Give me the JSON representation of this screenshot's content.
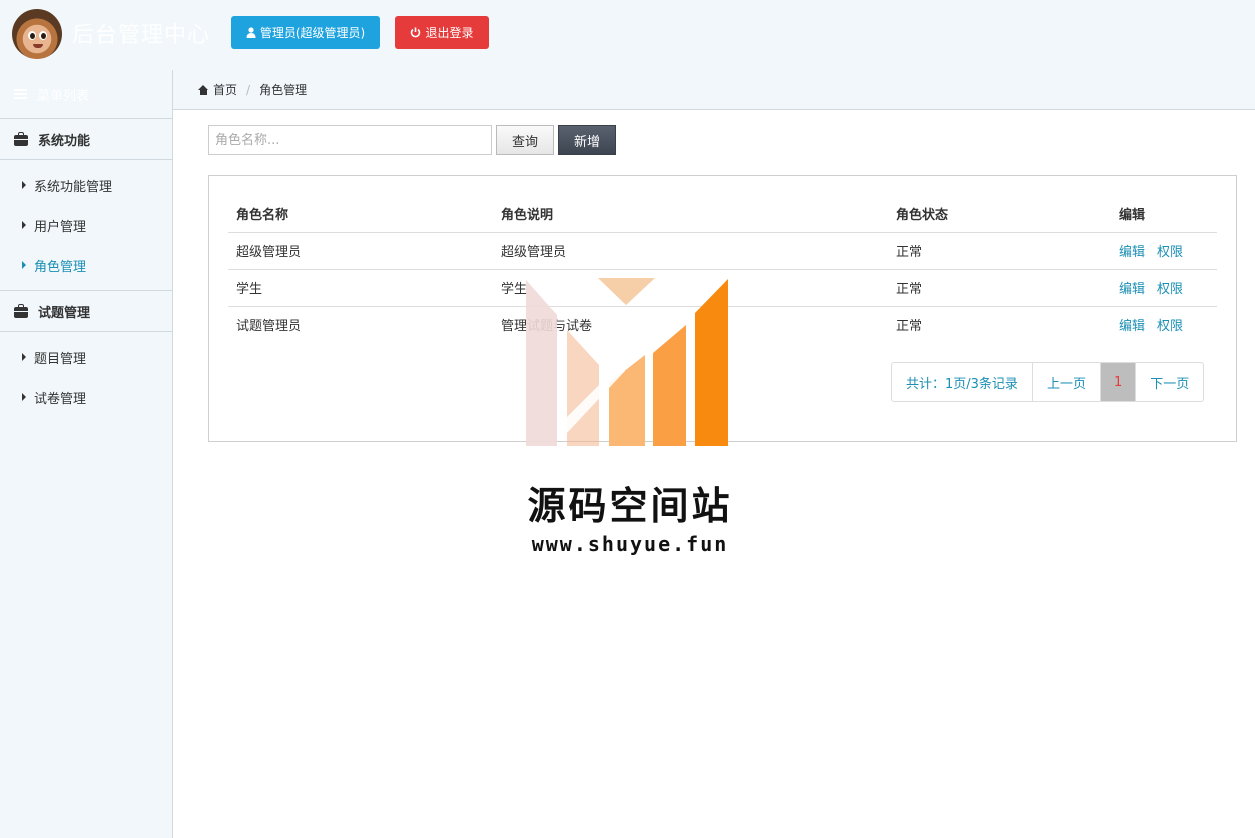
{
  "header": {
    "title": "后台管理中心",
    "admin_button": "管理员(超级管理员)",
    "logout_button": "退出登录"
  },
  "sidebar": {
    "menu_toggle": "菜单列表",
    "groups": [
      {
        "title": "系统功能",
        "items": [
          "系统功能管理",
          "用户管理",
          "角色管理"
        ]
      },
      {
        "title": "试题管理",
        "items": [
          "题目管理",
          "试卷管理"
        ]
      }
    ],
    "active_item": "角色管理"
  },
  "breadcrumb": {
    "home": "首页",
    "current": "角色管理"
  },
  "toolbar": {
    "search_placeholder": "角色名称...",
    "query_button": "查询",
    "add_button": "新增"
  },
  "table": {
    "headers": [
      "角色名称",
      "角色说明",
      "角色状态",
      "编辑"
    ],
    "rows": [
      {
        "name": "超级管理员",
        "desc": "超级管理员",
        "status": "正常",
        "edit": "编辑",
        "perm": "权限"
      },
      {
        "name": "学生",
        "desc": "学生",
        "status": "正常",
        "edit": "编辑",
        "perm": "权限"
      },
      {
        "name": "试题管理员",
        "desc": "管理试题与试卷",
        "status": "正常",
        "edit": "编辑",
        "perm": "权限"
      }
    ]
  },
  "pagination": {
    "summary": "共计：1页/3条记录",
    "prev": "上一页",
    "current": "1",
    "next": "下一页"
  },
  "watermark": {
    "title": "源码空间站",
    "url": "www.shuyue.fun"
  },
  "colors": {
    "accent": "#1b8fb5",
    "admin_button": "#1ea3df",
    "logout_button": "#e53b3b",
    "sidebar_bg": "#f1f7fb"
  }
}
